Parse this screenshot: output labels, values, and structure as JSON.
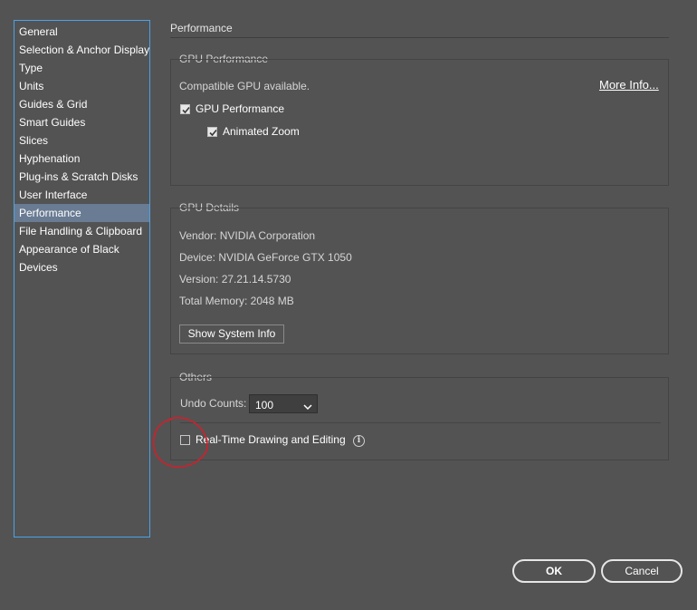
{
  "sidebar": {
    "items": [
      {
        "label": "General"
      },
      {
        "label": "Selection & Anchor Display"
      },
      {
        "label": "Type"
      },
      {
        "label": "Units"
      },
      {
        "label": "Guides & Grid"
      },
      {
        "label": "Smart Guides"
      },
      {
        "label": "Slices"
      },
      {
        "label": "Hyphenation"
      },
      {
        "label": "Plug-ins & Scratch Disks"
      },
      {
        "label": "User Interface"
      },
      {
        "label": "Performance"
      },
      {
        "label": "File Handling & Clipboard"
      },
      {
        "label": "Appearance of Black"
      },
      {
        "label": "Devices"
      }
    ],
    "active": "Performance"
  },
  "main": {
    "title": "Performance",
    "gpu_performance": {
      "label": "GPU Performance",
      "status": "Compatible GPU available.",
      "more_info": "More Info...",
      "gpu_checkbox": {
        "label": "GPU Performance",
        "checked": true
      },
      "zoom_checkbox": {
        "label": "Animated Zoom",
        "checked": true
      }
    },
    "gpu_details": {
      "label": "GPU Details",
      "vendor": "Vendor: NVIDIA Corporation",
      "device": "Device: NVIDIA GeForce GTX 1050",
      "version": "Version: 27.21.14.5730",
      "memory": "Total Memory: 2048 MB",
      "show_system_info": "Show System Info"
    },
    "others": {
      "label": "Others",
      "undo_label": "Undo Counts:",
      "undo_value": "100",
      "realtime_checkbox": {
        "label": "Real-Time Drawing and Editing",
        "checked": false
      },
      "info_icon": "info-icon"
    }
  },
  "footer": {
    "ok": "OK",
    "cancel": "Cancel"
  },
  "colors": {
    "background": "#535353",
    "sidebar_border": "#4aa3e8",
    "active_item": "#6a7c93",
    "annotation": "#d21f2b"
  }
}
